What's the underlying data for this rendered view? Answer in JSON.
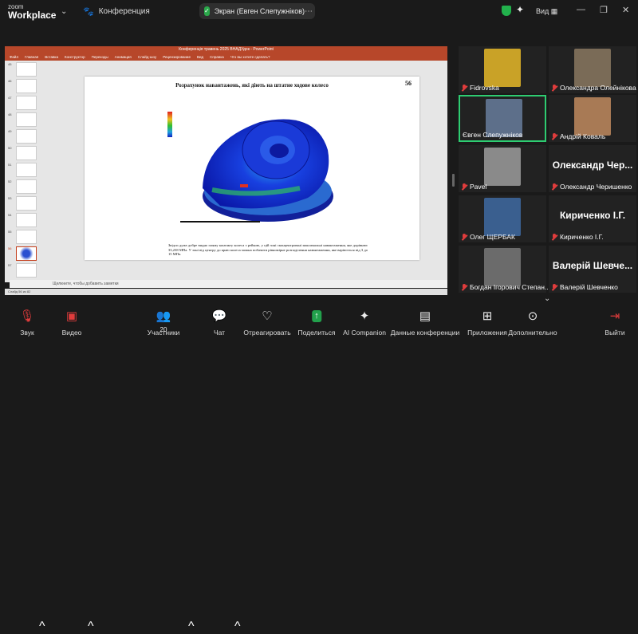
{
  "app": {
    "logo_top": "zoom",
    "logo_bottom": "Workplace",
    "meeting_title": "Конференция"
  },
  "share_indicator": {
    "label": "Экран (Евген Слепужніков)"
  },
  "view_label": "Вид",
  "powerpoint": {
    "window_title": "Конференція травень 2025 ВНАДУдок - PowerPoint",
    "tabs": [
      "Файл",
      "Главная",
      "Вставка",
      "Конструктор",
      "Переходы",
      "Анимация",
      "Слайд-шоу",
      "Рецензирование",
      "Вид",
      "Справка",
      "Что вы хотите сделать?"
    ],
    "thumb_numbers": [
      "45",
      "46",
      "47",
      "48",
      "49",
      "50",
      "51",
      "52",
      "53",
      "54",
      "55",
      "56",
      "57"
    ],
    "slide_title": "Розрахунок навантажень, які діють на штатне ходове колесо",
    "slide_number": "56",
    "slide_text": "Звідси дуже добре видно пляму контакту колеса з рейкою, у цій зоні сконцентровані максимальні навантаження, яке дорівнює 33,238 МПа. У зоні від центру до краю колеса можна побачити рівномірне розподілення навантаження, яке варіюється від 3 до 15 МПа.",
    "notes_placeholder": "Щелкните, чтобы добавить заметки",
    "status_text": "Слайд 56 из 82"
  },
  "participants": [
    {
      "name": "Fidrovska",
      "type": "photo",
      "color": "#c9a227"
    },
    {
      "name": "Олександра Олейнікова",
      "type": "photo",
      "color": "#7a6b57"
    },
    {
      "name": "Євген Слепужніков",
      "type": "photo",
      "color": "#5d6f8a",
      "active": true
    },
    {
      "name": "Андрій Коваль",
      "type": "photo",
      "color": "#a87a55"
    },
    {
      "name": "Pavel",
      "type": "photo",
      "color": "#8a8a8a"
    },
    {
      "name": "Олександр Черишенко",
      "big": "Олександр Чер...",
      "type": "name"
    },
    {
      "name": "Олег ЩЕРБАК",
      "type": "photo",
      "color": "#3a5f8f"
    },
    {
      "name": "Кириченко І.Г.",
      "big": "Кириченко І.Г.",
      "type": "name"
    },
    {
      "name": "Богдан Ігорович Степан...",
      "type": "photo",
      "color": "#6b6b6b"
    },
    {
      "name": "Валерій Шевченко",
      "big": "Валерій Шевче...",
      "type": "name"
    }
  ],
  "toolbar": {
    "audio": "Звук",
    "video": "Видео",
    "participants": "Участники",
    "participants_count": "20",
    "chat": "Чат",
    "react": "Отреагировать",
    "share": "Поделиться",
    "ai": "AI Companion",
    "data": "Данные конференции",
    "apps": "Приложения",
    "more": "Дополнительно",
    "leave": "Выйти"
  }
}
